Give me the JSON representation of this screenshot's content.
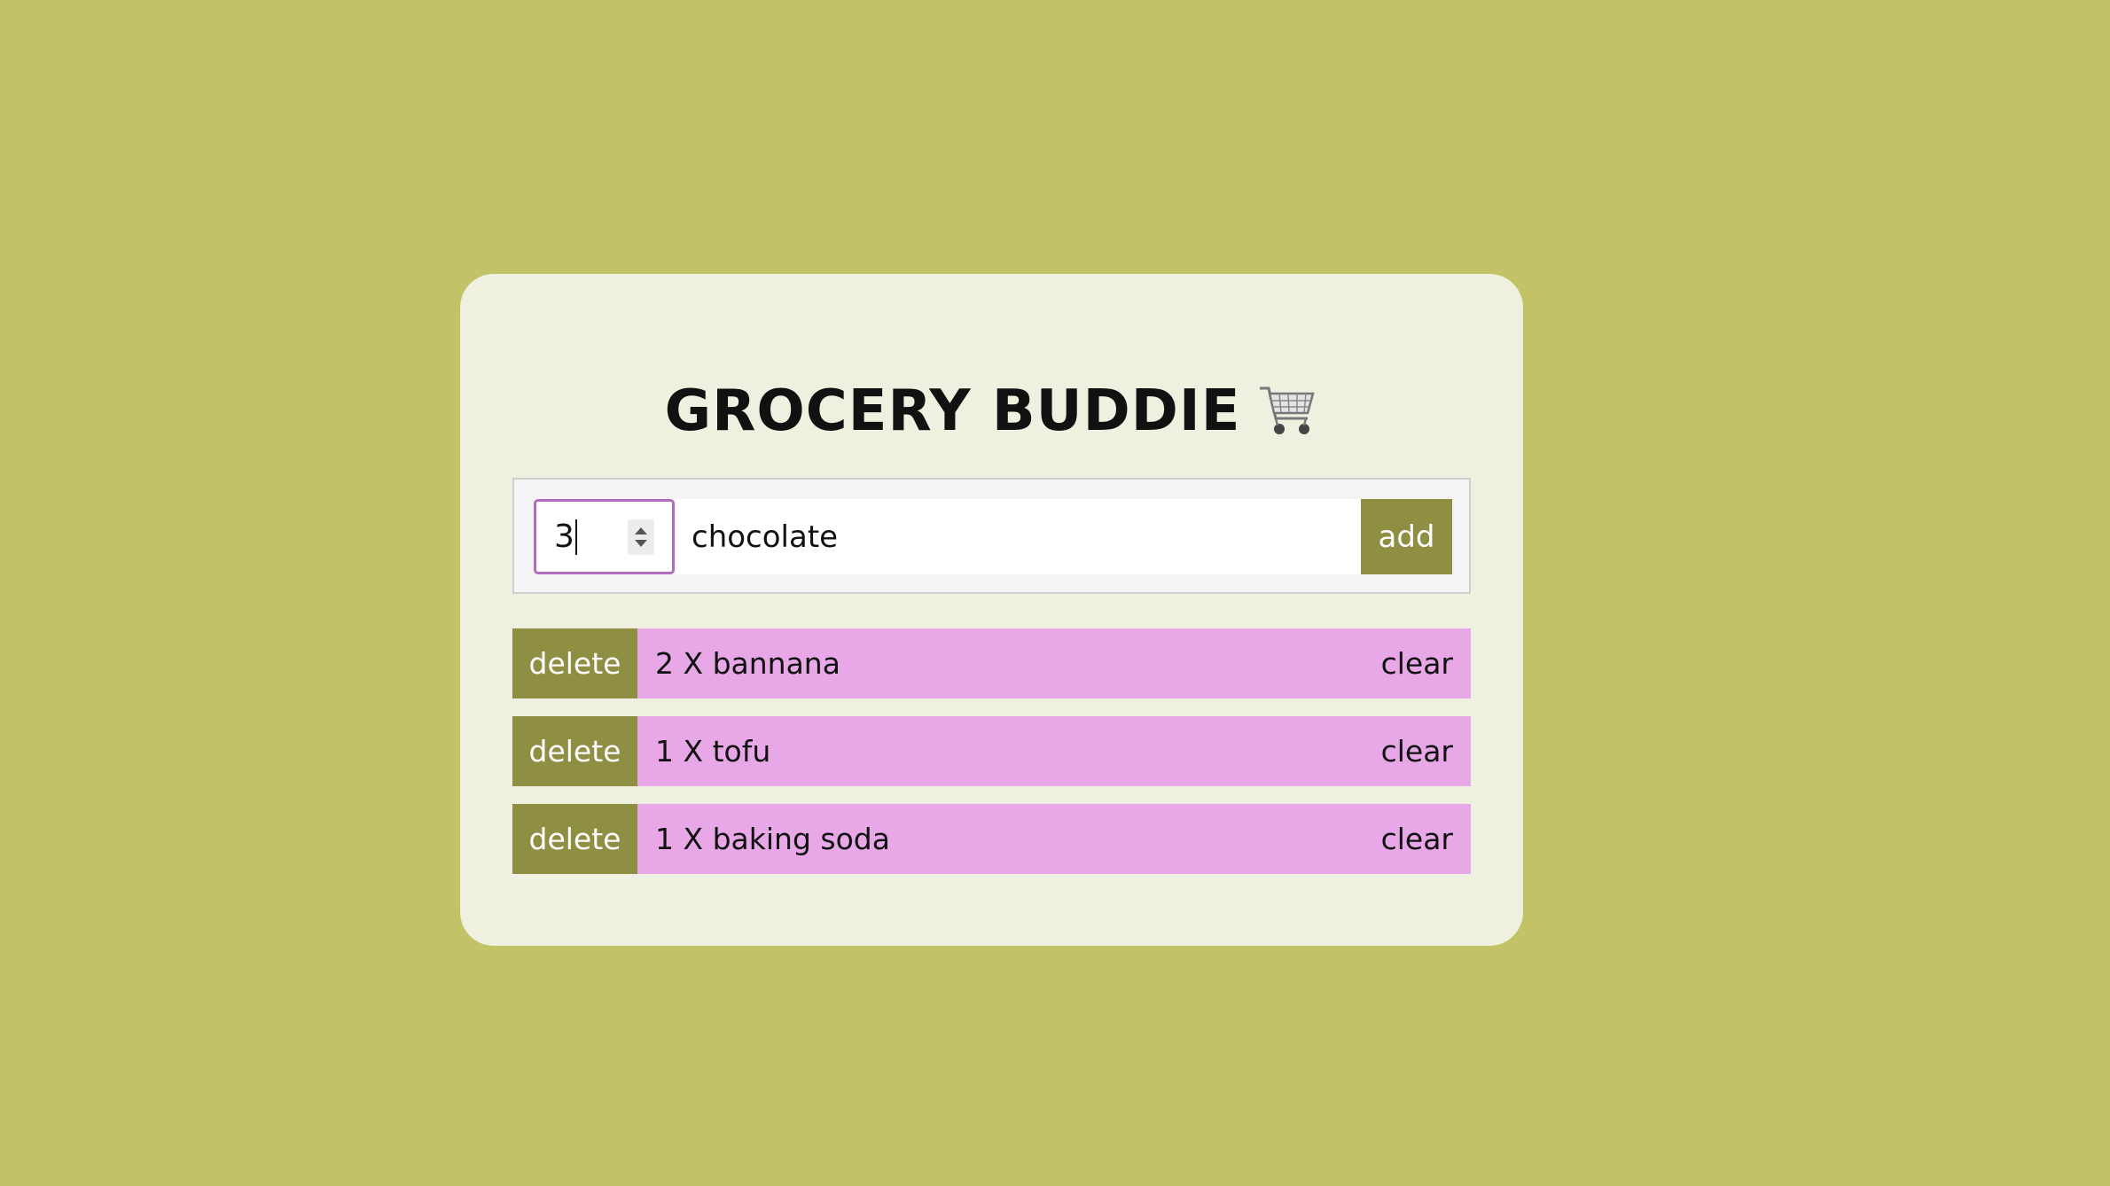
{
  "app": {
    "title": "GROCERY BUDDIE",
    "title_icon": "shopping-cart-icon"
  },
  "form": {
    "quantity_value": "3",
    "item_value": "chocolate",
    "add_label": "add"
  },
  "items": [
    {
      "text": "2 X bannana",
      "delete_label": "delete",
      "clear_label": "clear"
    },
    {
      "text": "1 X tofu",
      "delete_label": "delete",
      "clear_label": "clear"
    },
    {
      "text": "1 X baking soda",
      "delete_label": "delete",
      "clear_label": "clear"
    }
  ],
  "colors": {
    "background": "#c2c366",
    "card": "#f0f0e0",
    "button": "#8f8f44",
    "item_row": "#e8a8e8",
    "focus_border": "#b06cbe"
  }
}
